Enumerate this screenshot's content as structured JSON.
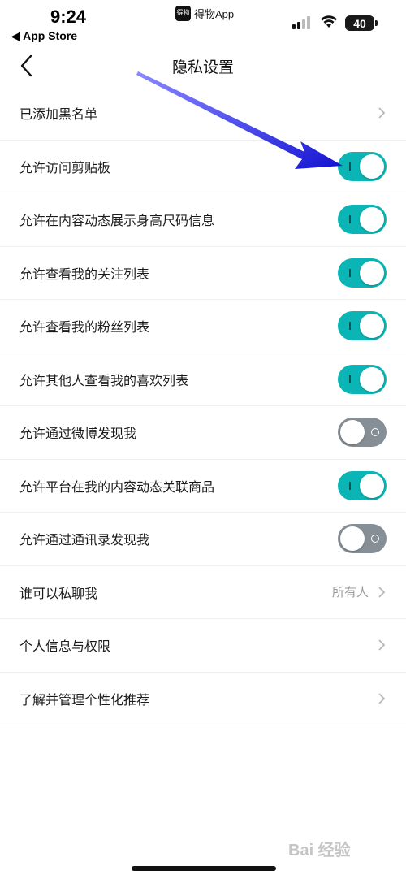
{
  "status_bar": {
    "time": "9:24",
    "back_app": "◀ App Store",
    "app_logo_text": "得物",
    "app_name": "得物App",
    "battery": "40",
    "icons": [
      "signal-icon",
      "wifi-icon",
      "battery-icon"
    ]
  },
  "nav": {
    "title": "隐私设置",
    "back_icon": "chevron-left-icon"
  },
  "rows": [
    {
      "label": "已添加黑名单",
      "type": "link"
    },
    {
      "label": "允许访问剪贴板",
      "type": "toggle",
      "on": true
    },
    {
      "label": "允许在内容动态展示身高尺码信息",
      "type": "toggle",
      "on": true
    },
    {
      "label": "允许查看我的关注列表",
      "type": "toggle",
      "on": true
    },
    {
      "label": "允许查看我的粉丝列表",
      "type": "toggle",
      "on": true
    },
    {
      "label": "允许其他人查看我的喜欢列表",
      "type": "toggle",
      "on": true
    },
    {
      "label": "允许通过微博发现我",
      "type": "toggle",
      "on": false
    },
    {
      "label": "允许平台在我的内容动态关联商品",
      "type": "toggle",
      "on": true
    },
    {
      "label": "允许通过通讯录发现我",
      "type": "toggle",
      "on": false
    },
    {
      "label": "谁可以私聊我",
      "type": "link",
      "value": "所有人"
    },
    {
      "label": "个人信息与权限",
      "type": "link"
    },
    {
      "label": "了解并管理个性化推荐",
      "type": "link"
    }
  ],
  "colors": {
    "toggle_on": "#0bb5b5",
    "toggle_off": "#868e96",
    "annotation_arrow": "#1a1ad6"
  },
  "watermark": "Bai 经验"
}
